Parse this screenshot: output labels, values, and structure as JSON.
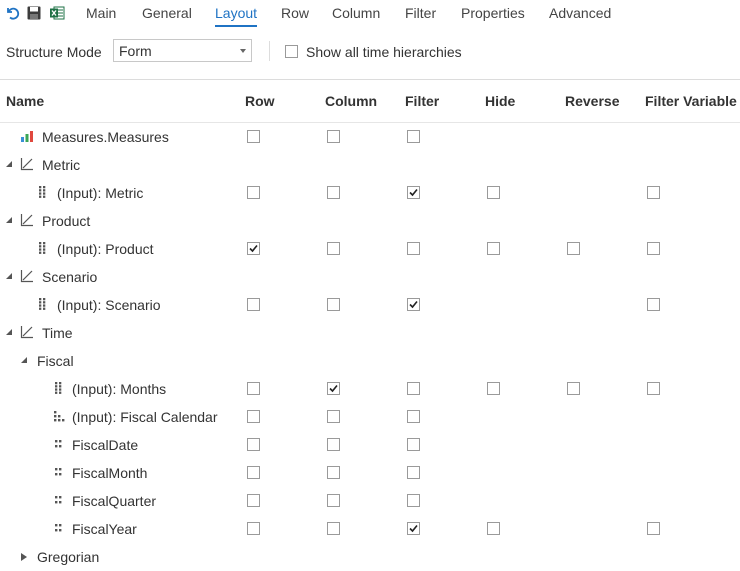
{
  "toolbar": {
    "icons": [
      "undo-icon",
      "save-icon",
      "excel-icon"
    ],
    "tabs": [
      {
        "label": "Main",
        "active": false
      },
      {
        "label": "General",
        "active": false
      },
      {
        "label": "Layout",
        "active": true
      },
      {
        "label": "Row",
        "active": false
      },
      {
        "label": "Column",
        "active": false
      },
      {
        "label": "Filter",
        "active": false
      },
      {
        "label": "Properties",
        "active": false
      },
      {
        "label": "Advanced",
        "active": false
      }
    ]
  },
  "options": {
    "structure_mode_label": "Structure Mode",
    "structure_mode_value": "Form",
    "show_time_label": "Show all time hierarchies",
    "show_time_checked": false
  },
  "columns": [
    "Name",
    "Row",
    "Column",
    "Filter",
    "Hide",
    "Reverse",
    "Filter Variable"
  ],
  "colors": {
    "accent": "#1f73c4",
    "measure_bars": [
      "#3a8fd6",
      "#3aa657",
      "#e0483e"
    ]
  },
  "rows": [
    {
      "label": "Measures.Measures",
      "icon": "measures-bar-icon",
      "level": 0,
      "expander": "none",
      "checks": {
        "row": false,
        "column": false,
        "filter": false
      }
    },
    {
      "label": "Metric",
      "icon": "dimension-axis-icon",
      "level": 0,
      "expander": "open",
      "checks": {}
    },
    {
      "label": "(Input): Metric",
      "icon": "hierarchy-grid-icon",
      "level": 1,
      "expander": "none",
      "checks": {
        "row": false,
        "column": false,
        "filter": true,
        "hide": false,
        "filter_variable": false
      }
    },
    {
      "label": "Product",
      "icon": "dimension-axis-icon",
      "level": 0,
      "expander": "open",
      "checks": {}
    },
    {
      "label": "(Input): Product",
      "icon": "hierarchy-grid-icon",
      "level": 1,
      "expander": "none",
      "checks": {
        "row": true,
        "column": false,
        "filter": false,
        "hide": false,
        "reverse": false,
        "filter_variable": false
      }
    },
    {
      "label": "Scenario",
      "icon": "dimension-axis-icon",
      "level": 0,
      "expander": "open",
      "checks": {}
    },
    {
      "label": "(Input): Scenario",
      "icon": "hierarchy-grid-icon",
      "level": 1,
      "expander": "none",
      "checks": {
        "row": false,
        "column": false,
        "filter": true,
        "filter_variable": false
      }
    },
    {
      "label": "Time",
      "icon": "dimension-axis-icon",
      "level": 0,
      "expander": "open",
      "checks": {}
    },
    {
      "label": "Fiscal",
      "icon": "",
      "level": 1,
      "expander": "open",
      "checks": {}
    },
    {
      "label": "(Input): Months",
      "icon": "hierarchy-grid-icon",
      "level": 2,
      "expander": "none",
      "checks": {
        "row": false,
        "column": true,
        "filter": false,
        "hide": false,
        "reverse": false,
        "filter_variable": false
      }
    },
    {
      "label": "(Input): Fiscal Calendar",
      "icon": "level-stairs-icon",
      "level": 2,
      "expander": "none",
      "checks": {
        "row": false,
        "column": false,
        "filter": false
      }
    },
    {
      "label": "FiscalDate",
      "icon": "level-dots-icon",
      "level": 2,
      "expander": "none",
      "checks": {
        "row": false,
        "column": false,
        "filter": false
      }
    },
    {
      "label": "FiscalMonth",
      "icon": "level-dots-icon",
      "level": 2,
      "expander": "none",
      "checks": {
        "row": false,
        "column": false,
        "filter": false
      }
    },
    {
      "label": "FiscalQuarter",
      "icon": "level-dots-icon",
      "level": 2,
      "expander": "none",
      "checks": {
        "row": false,
        "column": false,
        "filter": false
      }
    },
    {
      "label": "FiscalYear",
      "icon": "level-dots-icon",
      "level": 2,
      "expander": "none",
      "checks": {
        "row": false,
        "column": false,
        "filter": true,
        "hide": false,
        "filter_variable": false
      }
    },
    {
      "label": "Gregorian",
      "icon": "",
      "level": 1,
      "expander": "closed",
      "checks": {}
    }
  ]
}
